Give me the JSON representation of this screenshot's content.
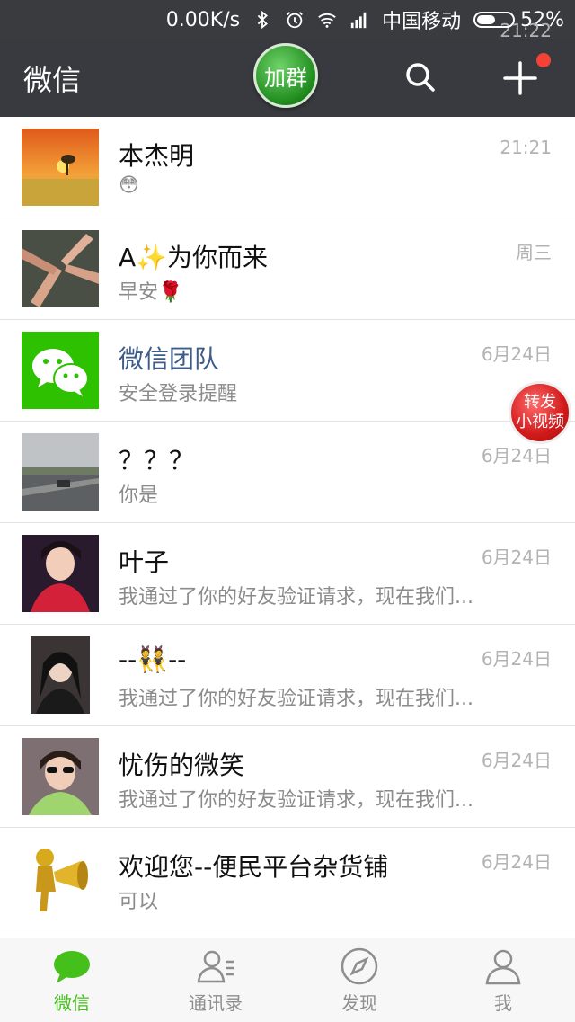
{
  "status_bar": {
    "time": "21:22",
    "network_speed": "0.00K/s",
    "carrier": "中国移动",
    "battery": "52%",
    "battery_level": 0.52
  },
  "header": {
    "title": "微信",
    "join_group_label": "加群",
    "notification_dot_color": "#f44336"
  },
  "floating_button": {
    "line1": "转发",
    "line2": "小视频"
  },
  "chats": [
    {
      "name": "本杰明",
      "preview": "😳",
      "time": "21:21",
      "avatar": "sunset"
    },
    {
      "name": "A✨为你而来",
      "preview": "早安🌹",
      "time": "周三",
      "avatar": "hands"
    },
    {
      "name": "微信团队",
      "preview": "安全登录提醒",
      "time": "6月24日",
      "avatar": "wechat-logo"
    },
    {
      "name": "？？？",
      "preview": "你是",
      "time": "6月24日",
      "avatar": "road"
    },
    {
      "name": "叶子",
      "preview": "我通过了你的好友验证请求，现在我们...",
      "time": "6月24日",
      "avatar": "portrait-red"
    },
    {
      "name": "--👯--",
      "preview": "我通过了你的好友验证请求，现在我们...",
      "time": "6月24日",
      "avatar": "portrait-dark"
    },
    {
      "name": "忧伤的微笑",
      "preview": "我通过了你的好友验证请求，现在我们...",
      "time": "6月24日",
      "avatar": "portrait-green"
    },
    {
      "name": "欢迎您--便民平台杂货铺",
      "preview": "可以",
      "time": "6月24日",
      "avatar": "gold-megaphone"
    }
  ],
  "tabs": [
    {
      "label": "微信",
      "icon": "chat-bubble-icon",
      "active": true
    },
    {
      "label": "通讯录",
      "icon": "contacts-icon",
      "active": false
    },
    {
      "label": "发现",
      "icon": "compass-icon",
      "active": false
    },
    {
      "label": "我",
      "icon": "person-icon",
      "active": false
    }
  ],
  "colors": {
    "accent": "#45c01a",
    "header_bg": "#393a3f",
    "team_name": "#3d5c8a"
  }
}
